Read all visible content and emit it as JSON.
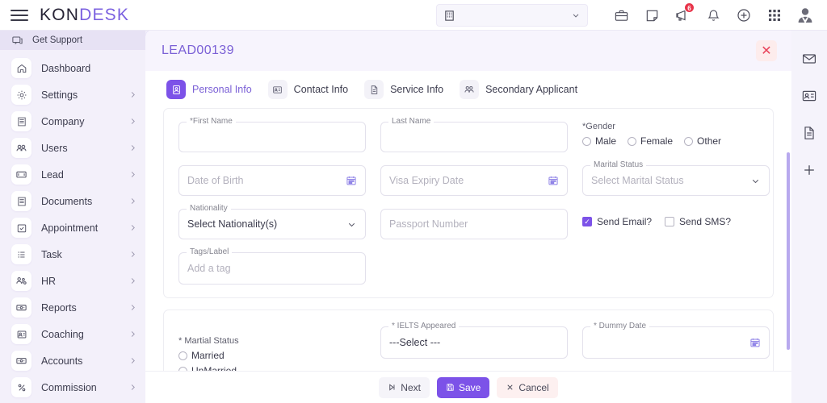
{
  "topbar": {
    "menu_icon": "hamburger-icon",
    "brand_first": "KON",
    "brand_second": "DESK",
    "company_select": {
      "value": "",
      "placeholder": "",
      "icon": "building-icon",
      "chevron": "chevron-down-icon"
    },
    "icons": [
      {
        "name": "briefcase-icon",
        "badge": ""
      },
      {
        "name": "note-icon",
        "badge": ""
      },
      {
        "name": "megaphone-icon",
        "badge": "6"
      },
      {
        "name": "bell-icon",
        "badge": ""
      },
      {
        "name": "plus-circle-icon",
        "badge": ""
      },
      {
        "name": "apps-grid-icon",
        "badge": ""
      },
      {
        "name": "avatar-icon",
        "badge": ""
      }
    ]
  },
  "sidebar": {
    "support": {
      "label": "Get Support",
      "icon": "support-chat-icon"
    },
    "items": [
      {
        "label": "Dashboard",
        "icon": "home-icon",
        "chevron": false
      },
      {
        "label": "Settings",
        "icon": "gear-icon",
        "chevron": true
      },
      {
        "label": "Company",
        "icon": "building-icon",
        "chevron": true
      },
      {
        "label": "Users",
        "icon": "users-icon",
        "chevron": true
      },
      {
        "label": "Lead",
        "icon": "card-icon",
        "chevron": true
      },
      {
        "label": "Documents",
        "icon": "documents-icon",
        "chevron": true
      },
      {
        "label": "Appointment",
        "icon": "calendar-check-icon",
        "chevron": true
      },
      {
        "label": "Task",
        "icon": "list-icon",
        "chevron": true
      },
      {
        "label": "HR",
        "icon": "people-icon",
        "chevron": true
      },
      {
        "label": "Reports",
        "icon": "report-icon",
        "chevron": true
      },
      {
        "label": "Coaching",
        "icon": "coaching-icon",
        "chevron": true
      },
      {
        "label": "Accounts",
        "icon": "accounts-icon",
        "chevron": true
      },
      {
        "label": "Commission",
        "icon": "percent-icon",
        "chevron": true
      }
    ]
  },
  "panel": {
    "lead_id": "LEAD00139",
    "close_label": "✕",
    "tabs": [
      {
        "label": "Personal Info",
        "icon": "person-badge-icon",
        "active": true
      },
      {
        "label": "Contact Info",
        "icon": "contact-card-icon",
        "active": false
      },
      {
        "label": "Service Info",
        "icon": "document-icon",
        "active": false
      },
      {
        "label": "Secondary Applicant",
        "icon": "two-people-icon",
        "active": false
      }
    ]
  },
  "form": {
    "first_name": {
      "label": "*First Name",
      "value": "",
      "placeholder": ""
    },
    "last_name": {
      "label": "Last Name",
      "value": "",
      "placeholder": ""
    },
    "gender": {
      "label": "*Gender",
      "options": [
        "Male",
        "Female",
        "Other"
      ],
      "selected": ""
    },
    "date_of_birth": {
      "label": "",
      "value": "",
      "placeholder": "Date of Birth",
      "icon": "calendar-icon"
    },
    "visa_expiry": {
      "label": "",
      "value": "",
      "placeholder": "Visa Expiry Date",
      "icon": "calendar-icon"
    },
    "marital_status_select": {
      "label": "Marital Status",
      "value": "Select Marital Status",
      "chevron": "chevron-down-icon"
    },
    "nationality": {
      "label": "Nationality",
      "value": "Select Nationality(s)",
      "chevron": "chevron-down-icon"
    },
    "passport": {
      "label": "",
      "value": "",
      "placeholder": "Passport Number"
    },
    "send_email": {
      "label": "Send Email?",
      "checked": true,
      "mark": "✓"
    },
    "send_sms": {
      "label": "Send SMS?",
      "checked": false,
      "mark": ""
    },
    "tags": {
      "label": "Tags/Label",
      "value": "",
      "placeholder": "Add a tag"
    },
    "martial_status_radio": {
      "label": "* Martial Status",
      "options": [
        "Married",
        "UnMarried"
      ],
      "selected": ""
    },
    "ielts_appeared": {
      "label": "* IELTS Appeared",
      "value": "---Select ---"
    },
    "dummy_date": {
      "label": "* Dummy Date",
      "value": "",
      "placeholder": "",
      "icon": "calendar-icon"
    }
  },
  "footer": {
    "next": {
      "label": "Next",
      "icon": "skip-forward-icon"
    },
    "save": {
      "label": "Save",
      "icon": "floppy-disk-icon"
    },
    "cancel": {
      "label": "Cancel",
      "icon": "close-icon"
    }
  },
  "rail": {
    "items": [
      {
        "name": "mail-icon"
      },
      {
        "name": "contact-card-icon"
      },
      {
        "name": "document-icon"
      },
      {
        "name": "plus-icon"
      }
    ]
  },
  "colors": {
    "accent": "#7c52e8",
    "accent_light": "#8b77e8",
    "lead_id": "#7a5fd6",
    "badge": "#e8344a",
    "sidebar_bg": "#f3f0fa",
    "panel_head_bg": "#f7f4fd"
  }
}
